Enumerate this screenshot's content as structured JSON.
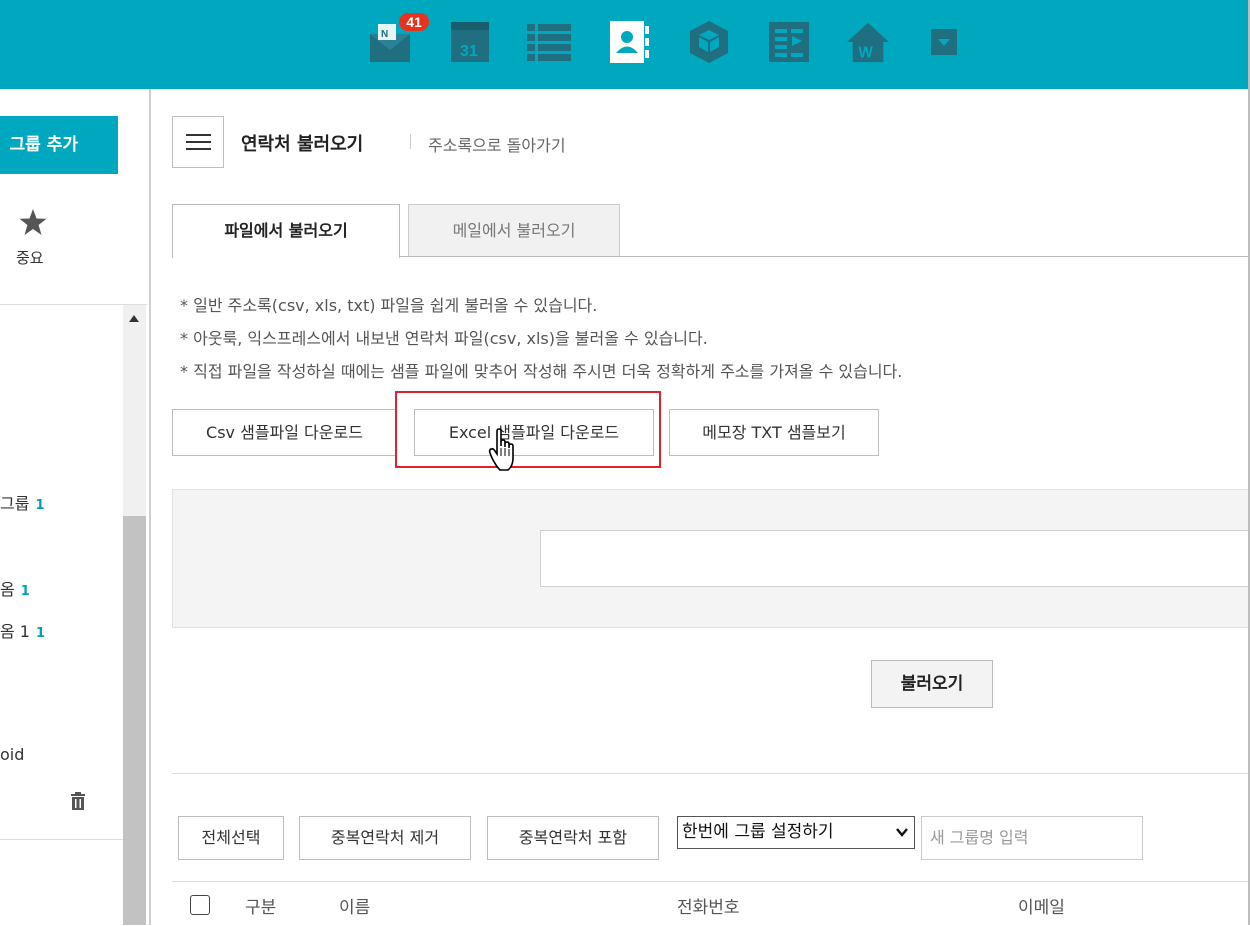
{
  "topbar": {
    "mail_badge": "41",
    "calendar_day": "31",
    "icons": [
      "mail-icon",
      "calendar-icon",
      "list-icon",
      "contacts-icon",
      "cube-icon",
      "board-icon",
      "home-w-icon",
      "dropdown-icon"
    ]
  },
  "sidebar": {
    "add_group_label": "그룹 추가",
    "favorites_label": "중요",
    "groups": [
      {
        "label": "그룹",
        "count": "1"
      },
      {
        "label": "옴",
        "count": "1"
      },
      {
        "label": "옴 1",
        "count": "1"
      },
      {
        "label": "oid",
        "count": ""
      }
    ]
  },
  "header": {
    "title": "연락처 불러오기",
    "back_link": "주소록으로 돌아가기"
  },
  "tabs": [
    {
      "label": "파일에서 불러오기",
      "active": true
    },
    {
      "label": "메일에서 불러오기",
      "active": false
    }
  ],
  "notes": [
    "일반 주소록(csv, xls, txt) 파일을 쉽게 불러올 수 있습니다.",
    "아웃룩, 익스프레스에서 내보낸 연락처 파일(csv, xls)을 불러올 수 있습니다.",
    "직접 파일을 작성하실 때에는 샘플 파일에 맞추어 작성해 주시면 더욱 정확하게 주소를 가져올 수 있습니다."
  ],
  "sample_buttons": {
    "csv": "Csv 샘플파일 다운로드",
    "excel": "Excel 샘플파일 다운로드",
    "txt": "메모장 TXT 샘플보기"
  },
  "import_button": "불러오기",
  "toolbar": {
    "select_all": "전체선택",
    "remove_duplicates": "중복연락처 제거",
    "include_duplicates": "중복연락처 포함",
    "group_select_value": "한번에 그룹 설정하기",
    "group_input_placeholder": "새 그룹명 입력"
  },
  "table_headers": {
    "type": "구분",
    "name": "이름",
    "phone": "전화번호",
    "email": "이메일"
  },
  "colors": {
    "topbar": "#00a8bf",
    "accent": "#00a8bf",
    "highlight": "#e0212f",
    "badge": "#e8321e"
  }
}
